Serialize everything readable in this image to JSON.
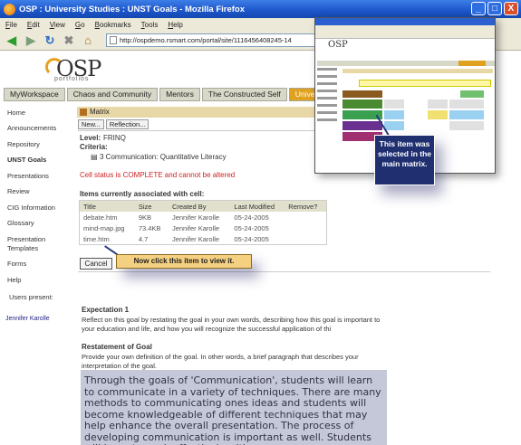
{
  "window": {
    "title": "OSP : University Studies : UNST Goals - Mozilla Firefox",
    "buttons": [
      "_",
      "□",
      "X"
    ]
  },
  "menu": [
    "File",
    "Edit",
    "View",
    "Go",
    "Bookmarks",
    "Tools",
    "Help"
  ],
  "address": "http://ospdemo.rsmart.com/portal/site/1116456408245-14",
  "logo": {
    "main": "OSP",
    "sub": "portfolios"
  },
  "site_tabs": [
    "MyWorkspace",
    "Chaos and Community",
    "Mentors",
    "The Constructed Self",
    "University"
  ],
  "tools": [
    "Home",
    "Announcements",
    "Repository",
    "UNST Goals",
    "Presentations",
    "Review",
    "CIG Information",
    "Glossary",
    "Presentation Templates",
    "Forms",
    "Help"
  ],
  "users_present": {
    "label": "Users present:",
    "name": "Jennifer Karolle"
  },
  "portlet": {
    "title": "Matrix",
    "new_btn": "New...",
    "reflection_btn": "Reflection...",
    "level_label": "Level:",
    "level_value": "FRINQ",
    "criteria_label": "Criteria:",
    "criteria_value": "3 Communication: Quantitative Literacy",
    "status_text": "Cell status is COMPLETE and cannot be altered",
    "items_heading": "Items currently associated with cell:",
    "columns": [
      "Title",
      "Size",
      "Created By",
      "Last Modified",
      "Remove?"
    ],
    "rows": [
      [
        "debate.htm",
        "9KB",
        "Jennifer Karolle",
        "05-24-2005"
      ],
      [
        "mind-map.jpg",
        "73.4KB",
        "Jennifer Karolle",
        "05-24-2005"
      ],
      [
        "time.htm",
        "4.7",
        "Jennifer Karolle",
        "05-24-2005"
      ]
    ],
    "cancel_btn": "Cancel"
  },
  "expectation": {
    "heading": "Expectation 1",
    "text": "Reflect on this goal by restating the goal in your own words, describing how this goal is important to your education and life, and how you will recognize the successful application of thi"
  },
  "restatement": {
    "heading": "Restatement of Goal",
    "text": "Provide your own definition of the goal. In other words, a brief paragraph that describes your interpretation of the goal."
  },
  "quote": "Through the goals of 'Communication', students will learn to communicate in a variety of techniques. There are many methods to communicating ones ideas and students will become knowledgeable of different techniques that may help enhance the overall presentation. The process of developing communication is important as well. Students will learn to work effectively with",
  "callouts": {
    "click_item": "Now click this item to view it.",
    "selected": "This item was selected in the main matrix."
  },
  "colors": {
    "tab_active": "#e0a020",
    "callout_dark": "#1f2f70",
    "callout_light": "#f5d080"
  }
}
